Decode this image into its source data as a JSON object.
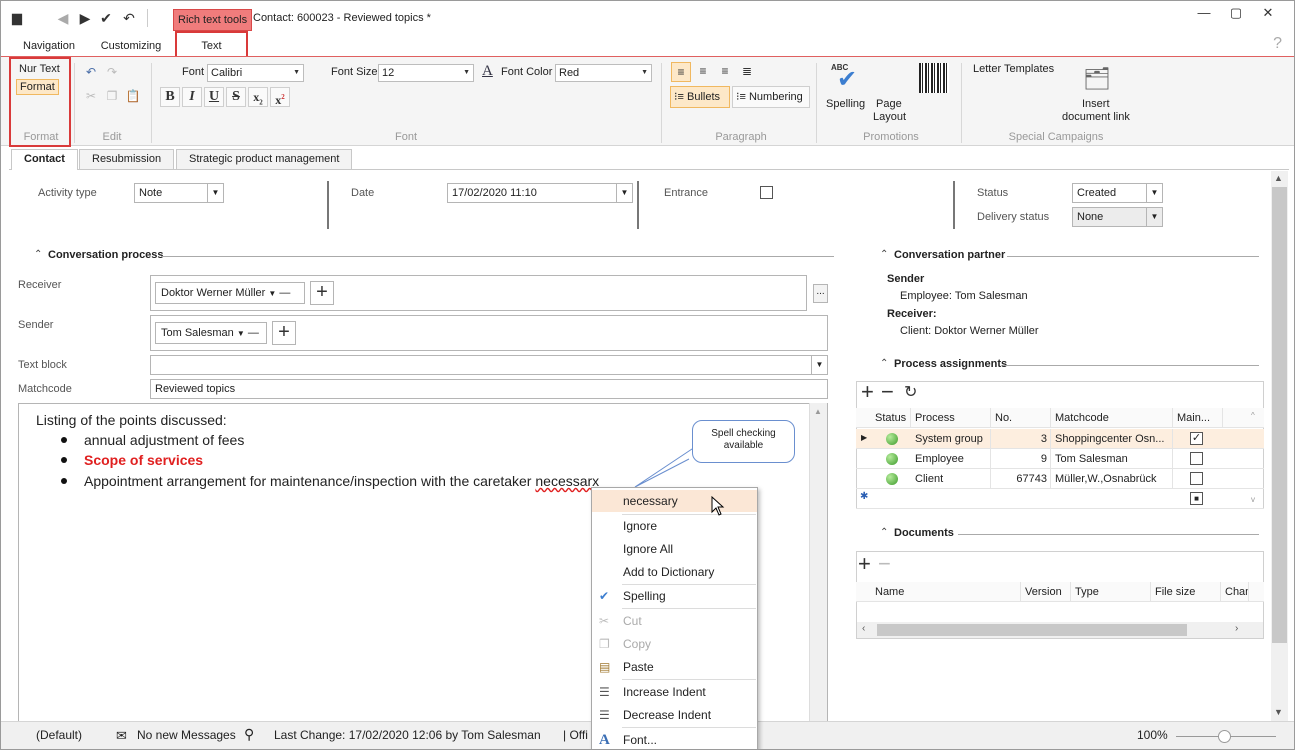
{
  "titlebar": {
    "context_tab": "Rich text tools",
    "title": "Contact: 600023 - Reviewed topics *"
  },
  "ribbon_tabs": [
    "Navigation",
    "Customizing",
    "Text"
  ],
  "ribbon": {
    "format_group": {
      "nur_text": "Nur Text",
      "format": "Format",
      "label": "Format"
    },
    "edit_group": {
      "label": "Edit"
    },
    "font_group": {
      "font_label": "Font",
      "font_value": "Calibri",
      "size_label": "Font Size",
      "size_value": "12",
      "color_label": "Font Color",
      "color_value": "Red",
      "bold": "B",
      "italic": "I",
      "underline": "U",
      "strike": "S",
      "label": "Font"
    },
    "paragraph_group": {
      "bullets": "Bullets",
      "numbering": "Numbering",
      "label": "Paragraph"
    },
    "promotions_group": {
      "spelling": "Spelling",
      "abc": "ABC",
      "page": "Page",
      "layout": "Layout",
      "label": "Promotions"
    },
    "campaigns_group": {
      "letter_templates": "Letter Templates",
      "insert": "Insert",
      "document_link": "document link",
      "label": "Special Campaigns"
    }
  },
  "doc_tabs": [
    "Contact",
    "Resubmission",
    "Strategic product management"
  ],
  "form": {
    "activity_type_label": "Activity type",
    "activity_type": "Note",
    "date_label": "Date",
    "date": "17/02/2020 11:10",
    "entrance_label": "Entrance",
    "status_label": "Status",
    "status": "Created",
    "delivery_status_label": "Delivery status",
    "delivery_status": "None"
  },
  "conversation": {
    "header": "Conversation process",
    "receiver_label": "Receiver",
    "receiver": "Doktor Werner Müller",
    "sender_label": "Sender",
    "sender": "Tom Salesman",
    "text_block_label": "Text block",
    "matchcode_label": "Matchcode",
    "matchcode": "Reviewed topics",
    "more_button": "..."
  },
  "editor": {
    "intro": "Listing of the points discussed:",
    "items": [
      "annual adjustment of fees",
      "Scope of services",
      "Appointment arrangement for maintenance/inspection with the caretaker necessary"
    ],
    "item3_main": "Appointment arrangement for maintenance/inspection with the caretaker ",
    "item3_misspelled": "necessarx",
    "red_color": "#e02020"
  },
  "callout": {
    "line1": "Spell checking",
    "line2": "available"
  },
  "context_menu": {
    "suggestion": "necessary",
    "ignore": "Ignore",
    "ignore_all": "Ignore All",
    "add_dictionary": "Add to Dictionary",
    "spelling": "Spelling",
    "cut": "Cut",
    "copy": "Copy",
    "paste": "Paste",
    "increase_indent": "Increase Indent",
    "decrease_indent": "Decrease Indent",
    "font": "Font..."
  },
  "partner": {
    "header": "Conversation partner",
    "sender_label": "Sender",
    "sender_value": "Employee: Tom Salesman",
    "receiver_label": "Receiver:",
    "receiver_value": "Client: Doktor Werner Müller"
  },
  "process": {
    "header": "Process assignments",
    "columns": [
      "Status",
      "Process",
      "No.",
      "Matchcode",
      "Main..."
    ],
    "rows": [
      {
        "process": "System group",
        "no": "3",
        "matchcode": "Shoppingcenter Osn...",
        "main": true
      },
      {
        "process": "Employee",
        "no": "9",
        "matchcode": "Tom Salesman",
        "main": false
      },
      {
        "process": "Client",
        "no": "67743",
        "matchcode": "Müller,W.,Osnabrück",
        "main": false
      }
    ]
  },
  "documents": {
    "header": "Documents",
    "columns": [
      "Name",
      "Version",
      "Type",
      "File size",
      "Chan"
    ]
  },
  "statusbar": {
    "default": "(Default)",
    "messages": "No new Messages",
    "last_change": "Last Change: 17/02/2020 12:06 by Tom Salesman",
    "office": "| Offi",
    "zoom": "100%"
  }
}
